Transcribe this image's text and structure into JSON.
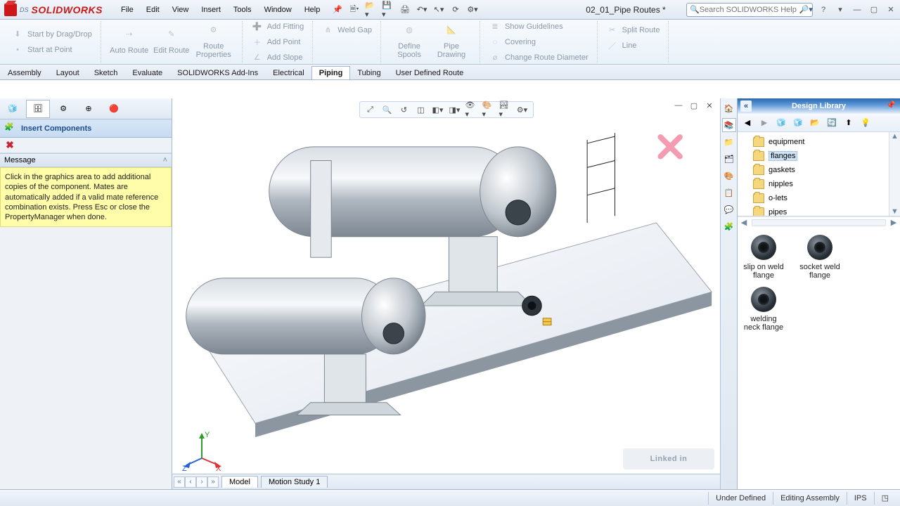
{
  "app": {
    "brand_ds": "DS",
    "brand": "SOLIDWORKS",
    "doc_name": "02_01_Pipe Routes *",
    "search_placeholder": "Search SOLIDWORKS Help"
  },
  "menus": [
    "File",
    "Edit",
    "View",
    "Insert",
    "Tools",
    "Window",
    "Help"
  ],
  "routing": {
    "left": [
      {
        "label": "Start by Drag/Drop"
      },
      {
        "label": "Start at Point"
      }
    ],
    "midv": [
      {
        "label": "Auto Route"
      },
      {
        "label": "Edit Route"
      },
      {
        "label": "Route Properties"
      }
    ],
    "col2": [
      {
        "label": "Add Fitting"
      },
      {
        "label": "Add Point"
      },
      {
        "label": "Add Slope"
      }
    ],
    "col2b": [
      {
        "label": "Weld Gap"
      }
    ],
    "col3v": [
      {
        "label": "Define Spools"
      },
      {
        "label": "Pipe Drawing"
      }
    ],
    "col4": [
      {
        "label": "Show Guidelines"
      },
      {
        "label": "Covering"
      },
      {
        "label": "Change Route Diameter"
      }
    ],
    "col4b": [
      {
        "label": "Split Route"
      },
      {
        "label": "Line"
      }
    ]
  },
  "cm_tabs": [
    "Assembly",
    "Layout",
    "Sketch",
    "Evaluate",
    "SOLIDWORKS Add-Ins",
    "Electrical",
    "Piping",
    "Tubing",
    "User Defined Route"
  ],
  "cm_active": "Piping",
  "pm": {
    "title": "Insert Components",
    "section": "Message",
    "message": "Click in the graphics area to add additional copies of the component. Mates are automatically added if a valid mate reference combination exists. Press Esc or close the PropertyManager when done."
  },
  "bottom_tabs": {
    "model": "Model",
    "motion": "Motion Study 1"
  },
  "design_library": {
    "title": "Design Library",
    "tree": [
      {
        "label": "equipment"
      },
      {
        "label": "flanges",
        "selected": true
      },
      {
        "label": "gaskets"
      },
      {
        "label": "nipples"
      },
      {
        "label": "o-lets"
      },
      {
        "label": "pipes"
      }
    ],
    "items": [
      {
        "label": "slip on weld flange"
      },
      {
        "label": "socket weld flange"
      },
      {
        "label": "welding neck flange"
      }
    ]
  },
  "status": {
    "underdefined": "Under Defined",
    "editing": "Editing Assembly",
    "units": "IPS"
  },
  "triad": {
    "x": "X",
    "y": "Y",
    "z": "Z"
  },
  "wm": "Linked in"
}
